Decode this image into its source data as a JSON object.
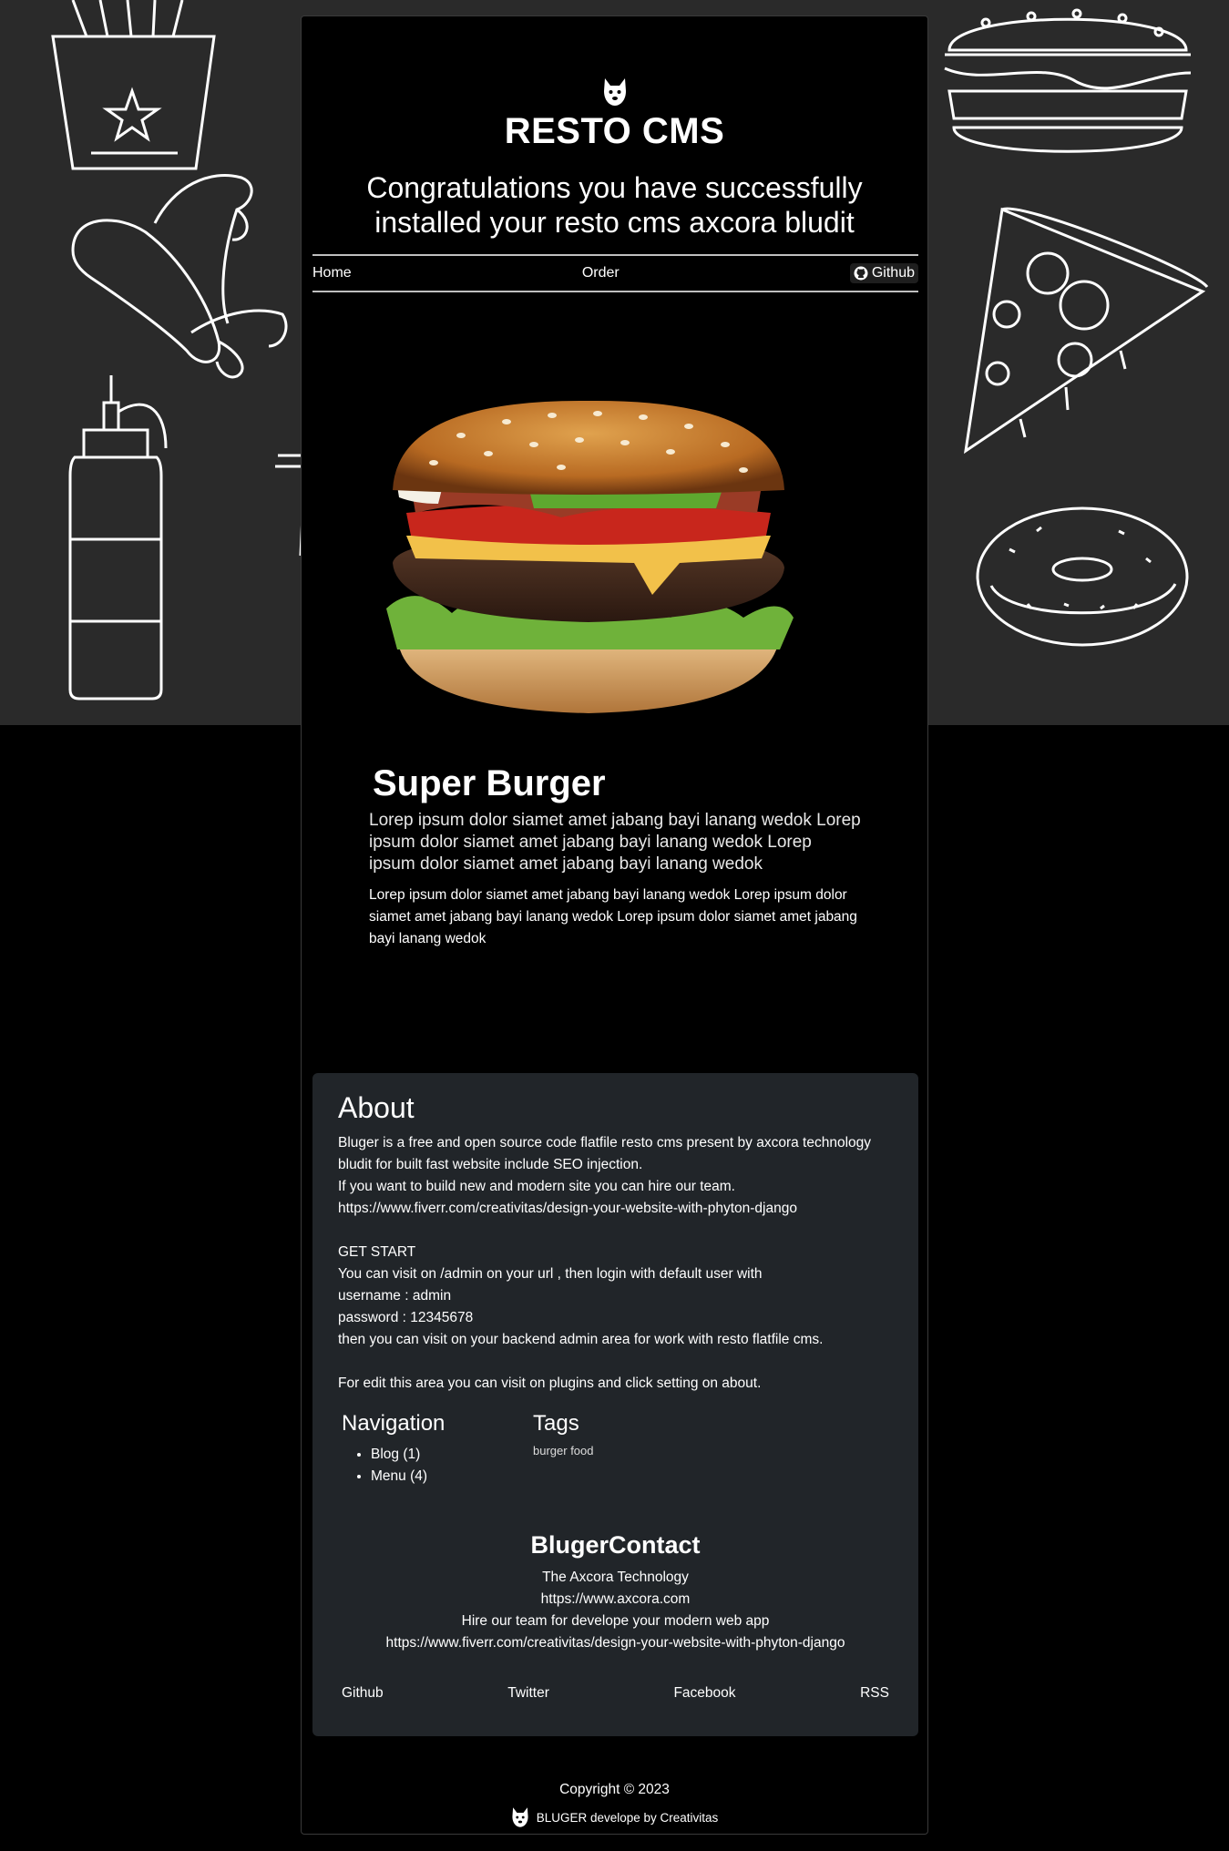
{
  "header": {
    "title": "RESTO CMS",
    "subtitle": "Congratulations you have successfully installed your resto cms axcora bludit"
  },
  "nav": {
    "home": "Home",
    "order": "Order",
    "github": "Github"
  },
  "post": {
    "title": "Super Burger",
    "lead": "Lorep ipsum dolor siamet amet jabang bayi lanang wedok Lorep ipsum dolor siamet amet jabang bayi lanang wedok Lorep ipsum dolor siamet amet jabang bayi lanang wedok",
    "body": "Lorep ipsum dolor siamet amet jabang bayi lanang wedok Lorep ipsum dolor siamet amet jabang bayi lanang wedok Lorep ipsum dolor siamet amet jabang bayi lanang wedok"
  },
  "about": {
    "title": "About",
    "text": "Bluger is a free and open source code flatfile resto cms present by axcora technology bludit for built fast website include SEO injection.\nIf you want to build new and modern site you can hire our team.\nhttps://www.fiverr.com/creativitas/design-your-website-with-phyton-django\n\nGET START\nYou can visit on /admin on your url , then login with default user with\nusername : admin\npassword : 12345678\nthen you can visit on your backend admin area for work with resto flatfile cms.\n\nFor edit this area you can visit on plugins and click setting on about."
  },
  "navigation": {
    "title": "Navigation",
    "items": [
      "Blog (1)",
      "Menu (4)"
    ]
  },
  "tags": {
    "title": "Tags",
    "items": [
      "burger food"
    ]
  },
  "contact": {
    "title": "BlugerContact",
    "lines": [
      "The Axcora Technology",
      "https://www.axcora.com",
      "Hire our team for develope your modern web app",
      "https://www.fiverr.com/creativitas/design-your-website-with-phyton-django"
    ]
  },
  "socials": [
    "Github",
    "Twitter",
    "Facebook",
    "RSS"
  ],
  "footer": {
    "copyright": "Copyright © 2023",
    "credit": "BLUGER develope by Creativitas"
  },
  "colors": {
    "page_bg": "#000000",
    "doodle_bg": "#2a2a2a",
    "card_bg": "#212529"
  },
  "icons": [
    "dog-logo-icon",
    "github-icon"
  ]
}
